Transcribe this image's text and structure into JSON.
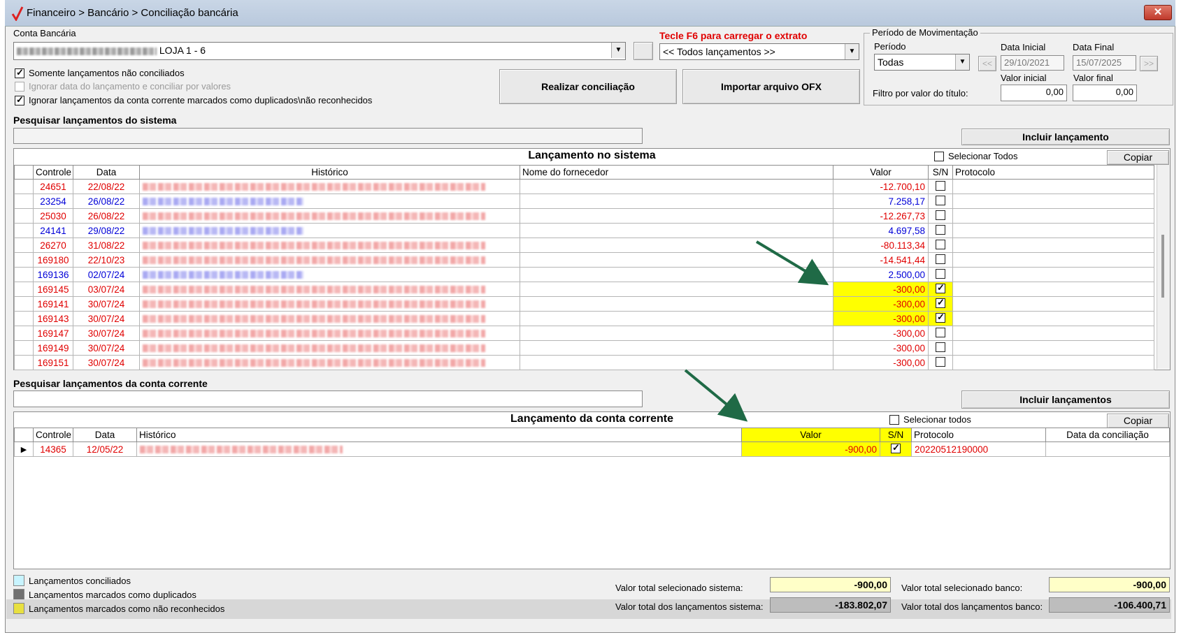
{
  "window": {
    "breadcrumb": "Financeiro > Bancário > Conciliação bancária",
    "close_label": "✕"
  },
  "conta": {
    "label": "Conta Bancária",
    "value_suffix": "LOJA 1 - 6",
    "ellipsis_label": "..."
  },
  "f6_hint": "Tecle F6 para carregar o extrato",
  "filtro_lancamentos": "<< Todos lançamentos >>",
  "options": {
    "somente_nao_conciliados": "Somente lançamentos não conciliados",
    "ignorar_data": "Ignorar data do lançamento e conciliar por valores",
    "ignorar_duplicados": "Ignorar lançamentos da conta corrente marcados como duplicados\\não reconhecidos"
  },
  "buttons": {
    "realizar": "Realizar conciliação",
    "importar": "Importar arquivo OFX",
    "incluir_lancamento": "Incluir lançamento",
    "incluir_lancamentos": "Incluir lançamentos",
    "copiar": "Copiar",
    "prev": "<<",
    "next": ">>"
  },
  "periodo": {
    "group_label": "Período de Movimentação",
    "periodo_label": "Período",
    "periodo_value": "Todas",
    "data_inicial_label": "Data Inicial",
    "data_inicial": "29/10/2021",
    "data_final_label": "Data Final",
    "data_final": "15/07/2025",
    "valor_inicial_label": "Valor inicial",
    "valor_inicial": "0,00",
    "valor_final_label": "Valor final",
    "valor_final": "0,00",
    "filtro_label": "Filtro por valor do título:"
  },
  "search_sistema_label": "Pesquisar lançamentos do sistema",
  "search_conta_label": "Pesquisar lançamentos da conta corrente",
  "sistema": {
    "title": "Lançamento no sistema",
    "select_all": "Selecionar Todos",
    "columns": [
      "Controle",
      "Data",
      "Histórico",
      "Nome do fornecedor",
      "Valor",
      "S/N",
      "Protocolo"
    ],
    "rows": [
      {
        "controle": "24651",
        "data": "22/08/22",
        "valor": "-12.700,10",
        "tipo": "red",
        "sel": false
      },
      {
        "controle": "23254",
        "data": "26/08/22",
        "valor": "7.258,17",
        "tipo": "blue",
        "sel": false
      },
      {
        "controle": "25030",
        "data": "26/08/22",
        "valor": "-12.267,73",
        "tipo": "red",
        "sel": false
      },
      {
        "controle": "24141",
        "data": "29/08/22",
        "valor": "4.697,58",
        "tipo": "blue",
        "sel": false
      },
      {
        "controle": "26270",
        "data": "31/08/22",
        "valor": "-80.113,34",
        "tipo": "red",
        "sel": false
      },
      {
        "controle": "169180",
        "data": "22/10/23",
        "valor": "-14.541,44",
        "tipo": "red",
        "sel": false
      },
      {
        "controle": "169136",
        "data": "02/07/24",
        "valor": "2.500,00",
        "tipo": "blue",
        "sel": false
      },
      {
        "controle": "169145",
        "data": "03/07/24",
        "valor": "-300,00",
        "tipo": "red",
        "sel": true
      },
      {
        "controle": "169141",
        "data": "30/07/24",
        "valor": "-300,00",
        "tipo": "red",
        "sel": true
      },
      {
        "controle": "169143",
        "data": "30/07/24",
        "valor": "-300,00",
        "tipo": "red",
        "sel": true
      },
      {
        "controle": "169147",
        "data": "30/07/24",
        "valor": "-300,00",
        "tipo": "red",
        "sel": false
      },
      {
        "controle": "169149",
        "data": "30/07/24",
        "valor": "-300,00",
        "tipo": "red",
        "sel": false
      },
      {
        "controle": "169151",
        "data": "30/07/24",
        "valor": "-300,00",
        "tipo": "red",
        "sel": false
      }
    ]
  },
  "conta_corrente": {
    "title": "Lançamento da conta corrente",
    "select_all": "Selecionar todos",
    "columns": [
      "Controle",
      "Data",
      "Histórico",
      "Valor",
      "S/N",
      "Protocolo",
      "Data da conciliação"
    ],
    "rows": [
      {
        "controle": "14365",
        "data": "12/05/22",
        "valor": "-900,00",
        "protocolo": "20220512190000",
        "sel": true
      }
    ]
  },
  "legend": {
    "conciliados": "Lançamentos conciliados",
    "duplicados": "Lançamentos marcados como duplicados",
    "nao_reconhecidos": "Lançamentos marcados como não reconhecidos",
    "colors": {
      "conciliados": "#c8f4ff",
      "duplicados": "#707070",
      "nao_reconhecidos": "#e8e040"
    }
  },
  "totals": {
    "sel_sistema_label": "Valor total selecionado sistema:",
    "sel_sistema": "-900,00",
    "sel_banco_label": "Valor total selecionado banco:",
    "sel_banco": "-900,00",
    "tot_sistema_label": "Valor total dos lançamentos sistema:",
    "tot_sistema": "-183.802,07",
    "tot_banco_label": "Valor total dos lançamentos banco:",
    "tot_banco": "-106.400,71"
  }
}
